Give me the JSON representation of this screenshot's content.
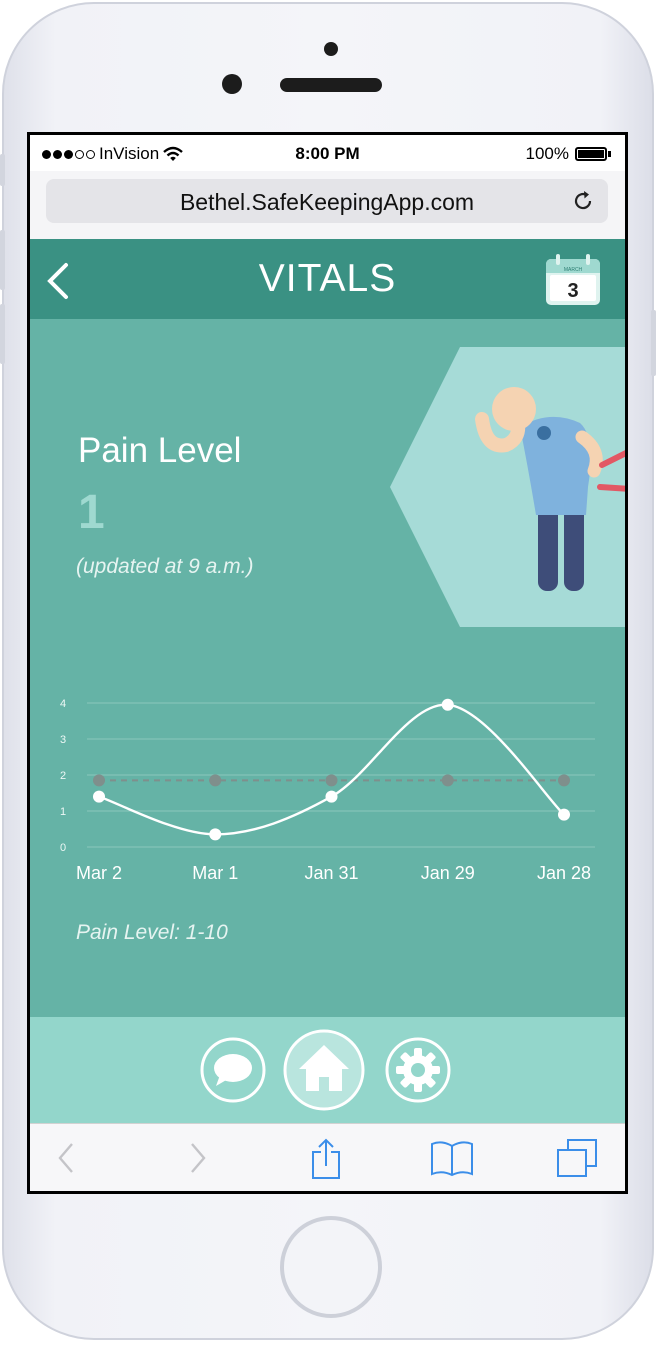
{
  "status_bar": {
    "carrier": "InVision",
    "time": "8:00 PM",
    "battery": "100%"
  },
  "browser": {
    "url": "Bethel.SafeKeepingApp.com",
    "reload_icon": "reload-icon"
  },
  "header": {
    "title": "VITALS",
    "calendar_month": "MARCH",
    "calendar_day": "3",
    "back_icon": "chevron-left-icon"
  },
  "vital": {
    "name": "Pain Level",
    "value": "1",
    "updated": "(updated at 9 a.m.)"
  },
  "chart_data": {
    "type": "line",
    "categories": [
      "Mar 2",
      "Mar 1",
      "Jan 31",
      "Jan 29",
      "Jan 28"
    ],
    "y_ticks": [
      "0",
      "1",
      "2",
      "3",
      "4"
    ],
    "ylim": [
      0,
      4
    ],
    "grid": true,
    "series": [
      {
        "values": [
          1.4,
          0.35,
          1.4,
          3.95,
          0.9
        ],
        "style": "solid-white"
      },
      {
        "values": [
          1.85,
          1.85,
          1.85,
          1.85,
          1.85
        ],
        "style": "dashed-gray"
      }
    ]
  },
  "scale_note": "Pain Level: 1-10",
  "bottom_nav": {
    "items": [
      "chat-icon",
      "home-icon",
      "gear-icon"
    ],
    "active": "home-icon"
  },
  "safari_toolbar": {
    "items": [
      "back-icon",
      "forward-icon",
      "share-icon",
      "bookmarks-icon",
      "tabs-icon"
    ]
  },
  "colors": {
    "header": "#3a9183",
    "body": "#65b3a6",
    "nav": "#93d6cb",
    "accent": "#9fd9d0",
    "ios_blue": "#3b8ee9"
  }
}
